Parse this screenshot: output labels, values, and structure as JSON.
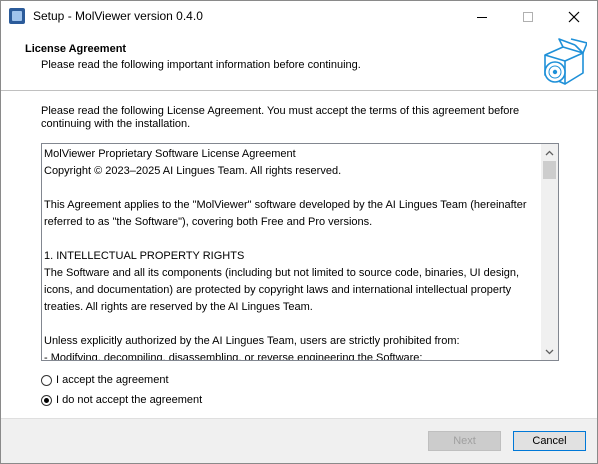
{
  "window": {
    "title": "Setup - MolViewer version 0.4.0"
  },
  "header": {
    "title": "License Agreement",
    "subtitle": "Please read the following important information before continuing."
  },
  "intro": "Please read the following License Agreement. You must accept the terms of this agreement before continuing with the installation.",
  "license": {
    "lines": [
      "MolViewer Proprietary Software License Agreement",
      "Copyright © 2023–2025 AI Lingues Team. All rights reserved.",
      "",
      "This Agreement applies to the \"MolViewer\" software developed by the AI Lingues Team (hereinafter",
      "referred to as \"the Software\"), covering both Free and Pro versions.",
      "",
      "1. INTELLECTUAL PROPERTY RIGHTS",
      "The Software and all its components (including but not limited to source code, binaries, UI design,",
      "icons, and documentation) are protected by copyright laws and international intellectual property",
      "treaties. All rights are reserved by the AI Lingues Team.",
      "",
      "Unless explicitly authorized by the AI Lingues Team, users are strictly prohibited from:",
      "- Modifying, decompiling, disassembling, or reverse engineering the Software;"
    ]
  },
  "options": {
    "accept": "I accept the agreement",
    "decline": "I do not accept the agreement",
    "selected": "decline"
  },
  "buttons": {
    "next": "Next",
    "cancel": "Cancel"
  },
  "icons": {
    "app": "setup-app-icon",
    "header": "install-box-disc-icon",
    "minimize": "minimize-icon",
    "maximize": "maximize-icon",
    "close": "close-icon",
    "scroll_up": "scroll-up-arrow-icon",
    "scroll_down": "scroll-down-arrow-icon"
  },
  "colors": {
    "header_graphic": "#1e90d8",
    "cancel_focus_border": "#0078d7"
  }
}
